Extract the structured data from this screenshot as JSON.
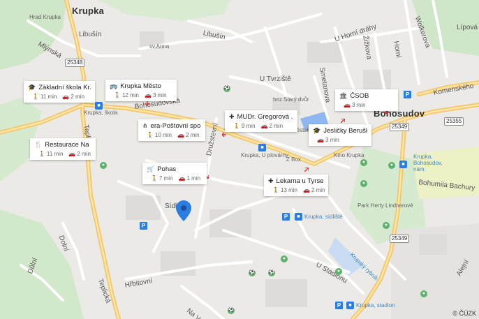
{
  "map": {
    "town_labels": [
      {
        "id": "krupka",
        "text": "Krupka"
      },
      {
        "id": "bohosudov",
        "text": "Bohosudov"
      }
    ],
    "street_labels": [
      {
        "id": "hrad",
        "text": "Hrad Krupka"
      },
      {
        "id": "libusin1",
        "text": "Libušín"
      },
      {
        "id": "libusin2",
        "text": "Libušín"
      },
      {
        "id": "svanna",
        "text": "sv.Anna"
      },
      {
        "id": "mlynska",
        "text": "Mlýnská"
      },
      {
        "id": "uhornidrahy",
        "text": "U Horní dráhy"
      },
      {
        "id": "zizkova",
        "text": "Žižkova"
      },
      {
        "id": "horni",
        "text": "Horní"
      },
      {
        "id": "wolkerova",
        "text": "Wolkerova"
      },
      {
        "id": "lipova",
        "text": "Lípová"
      },
      {
        "id": "utvrziste",
        "text": "U Tvrziště"
      },
      {
        "id": "tvrz",
        "text": "tvrz Starý dvůr"
      },
      {
        "id": "bohosudovska",
        "text": "Bohosudovská"
      },
      {
        "id": "druzstevni",
        "text": "Družstevní"
      },
      {
        "id": "mestsky",
        "text": "Městský"
      },
      {
        "id": "smetanova",
        "text": "Smetanova"
      },
      {
        "id": "komenskeho",
        "text": "Komenského"
      },
      {
        "id": "krupkaskola",
        "text": "Krupka, škola"
      },
      {
        "id": "teplicka",
        "text": "Teplická"
      },
      {
        "id": "krupkauplovarny",
        "text": "Krupka, U plovárny"
      },
      {
        "id": "zbox",
        "text": "Z Box"
      },
      {
        "id": "kinokrupka",
        "text": "Kino Krupka"
      },
      {
        "id": "krupkabohosudovnam",
        "text": "Krupka, Bohosudov, nám."
      },
      {
        "id": "bohumila",
        "text": "Bohumila Bachury"
      },
      {
        "id": "parkherty",
        "text": "Park Herty Lindnerové"
      },
      {
        "id": "sidl",
        "text": "Sídl."
      },
      {
        "id": "krupkasidliste",
        "text": "Krupka, sídliště"
      },
      {
        "id": "ustadionu",
        "text": "U Stadionu"
      },
      {
        "id": "krupskyrybnik",
        "text": "Krupský rybník"
      },
      {
        "id": "hrbitovni",
        "text": "Hřbitovní"
      },
      {
        "id": "teplicka2",
        "text": "Teplická"
      },
      {
        "id": "dolni",
        "text": "Dolní"
      },
      {
        "id": "duly",
        "text": "Důlní"
      },
      {
        "id": "krupkastadion",
        "text": "Krupka, stadion"
      },
      {
        "id": "alejni",
        "text": "Alejní"
      },
      {
        "id": "nav",
        "text": "Na V"
      }
    ],
    "road_shields": [
      "25348",
      "25349",
      "25355",
      "25349",
      "25349"
    ],
    "copyright": "© ČÚZK"
  },
  "cards": [
    {
      "id": "zakladni",
      "icon": "school-icon",
      "glyph": "🎓",
      "title": "Základní škola Kr...",
      "walk": "11 min",
      "drive": "2 min"
    },
    {
      "id": "krupkamesto",
      "icon": "bus-icon",
      "glyph": "🚌",
      "title": "Krupka Město",
      "walk": "12 min",
      "drive": "3 min"
    },
    {
      "id": "mudr",
      "icon": "medical-icon",
      "glyph": "✚",
      "title": "MUDr. Gregorová ...",
      "walk": "9 min",
      "drive": "2 min"
    },
    {
      "id": "csob",
      "icon": "bank-icon",
      "glyph": "🏛",
      "title": "ČSOB",
      "walk": "",
      "drive": "3 min"
    },
    {
      "id": "posta",
      "icon": "network-icon",
      "glyph": "⋔",
      "title": "era-Poštovní spoř...",
      "walk": "10 min",
      "drive": "2 min"
    },
    {
      "id": "restaurace",
      "icon": "restaurant-icon",
      "glyph": "🍴",
      "title": "Restaurace Na R...",
      "walk": "11 min",
      "drive": "2 min"
    },
    {
      "id": "jeslicky",
      "icon": "school-icon",
      "glyph": "🎓",
      "title": "Jesličky Beruška",
      "walk": "",
      "drive": "3 min"
    },
    {
      "id": "pohas",
      "icon": "shopping-cart-icon",
      "glyph": "🛒",
      "title": "Pohas",
      "walk": "7 min",
      "drive": "1 min"
    },
    {
      "id": "lekarna",
      "icon": "medical-icon",
      "glyph": "✚",
      "title": "Lekarna u Tyrse",
      "walk": "13 min",
      "drive": "2 min"
    }
  ],
  "icons": {
    "walk": "🚶",
    "drive": "🚗",
    "parking": "P",
    "bus": "🚌",
    "pin_color": "#2a7de1",
    "accent_green": "#5bb26b",
    "road_major": "#f7d37e"
  }
}
